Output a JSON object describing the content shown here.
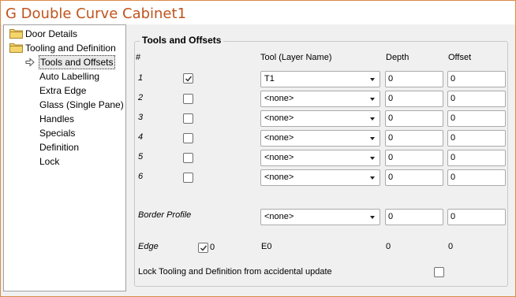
{
  "window": {
    "title": "G Double Curve Cabinet1",
    "accent": "#c0541c"
  },
  "tree": {
    "items": [
      {
        "label": "Door Details",
        "icon": "folder-icon"
      },
      {
        "label": "Tooling and Definition",
        "icon": "folder-icon"
      },
      {
        "label": "Tools and Offsets",
        "icon": "arrow-right-icon",
        "selected": true
      },
      {
        "label": "Auto Labelling"
      },
      {
        "label": "Extra Edge"
      },
      {
        "label": "Glass (Single Pane)"
      },
      {
        "label": "Handles"
      },
      {
        "label": "Specials"
      },
      {
        "label": "Definition"
      },
      {
        "label": "Lock"
      }
    ]
  },
  "panel": {
    "title": "Tools and Offsets",
    "headers": {
      "num": "#",
      "tool": "Tool (Layer Name)",
      "depth": "Depth",
      "offset": "Offset"
    },
    "rows": [
      {
        "num": "1",
        "checked": true,
        "tool": "T1",
        "depth": "0",
        "offset": "0"
      },
      {
        "num": "2",
        "checked": false,
        "tool": "<none>",
        "depth": "0",
        "offset": "0"
      },
      {
        "num": "3",
        "checked": false,
        "tool": "<none>",
        "depth": "0",
        "offset": "0"
      },
      {
        "num": "4",
        "checked": false,
        "tool": "<none>",
        "depth": "0",
        "offset": "0"
      },
      {
        "num": "5",
        "checked": false,
        "tool": "<none>",
        "depth": "0",
        "offset": "0"
      },
      {
        "num": "6",
        "checked": false,
        "tool": "<none>",
        "depth": "0",
        "offset": "0"
      }
    ],
    "border_profile": {
      "label": "Border Profile",
      "tool": "<none>",
      "depth": "0",
      "offset": "0"
    },
    "edge": {
      "label": "Edge",
      "checked": true,
      "count": "0",
      "tool": "E0",
      "depth": "0",
      "offset": "0"
    },
    "lock": {
      "label": "Lock Tooling and Definition from accidental update",
      "checked": false
    }
  }
}
